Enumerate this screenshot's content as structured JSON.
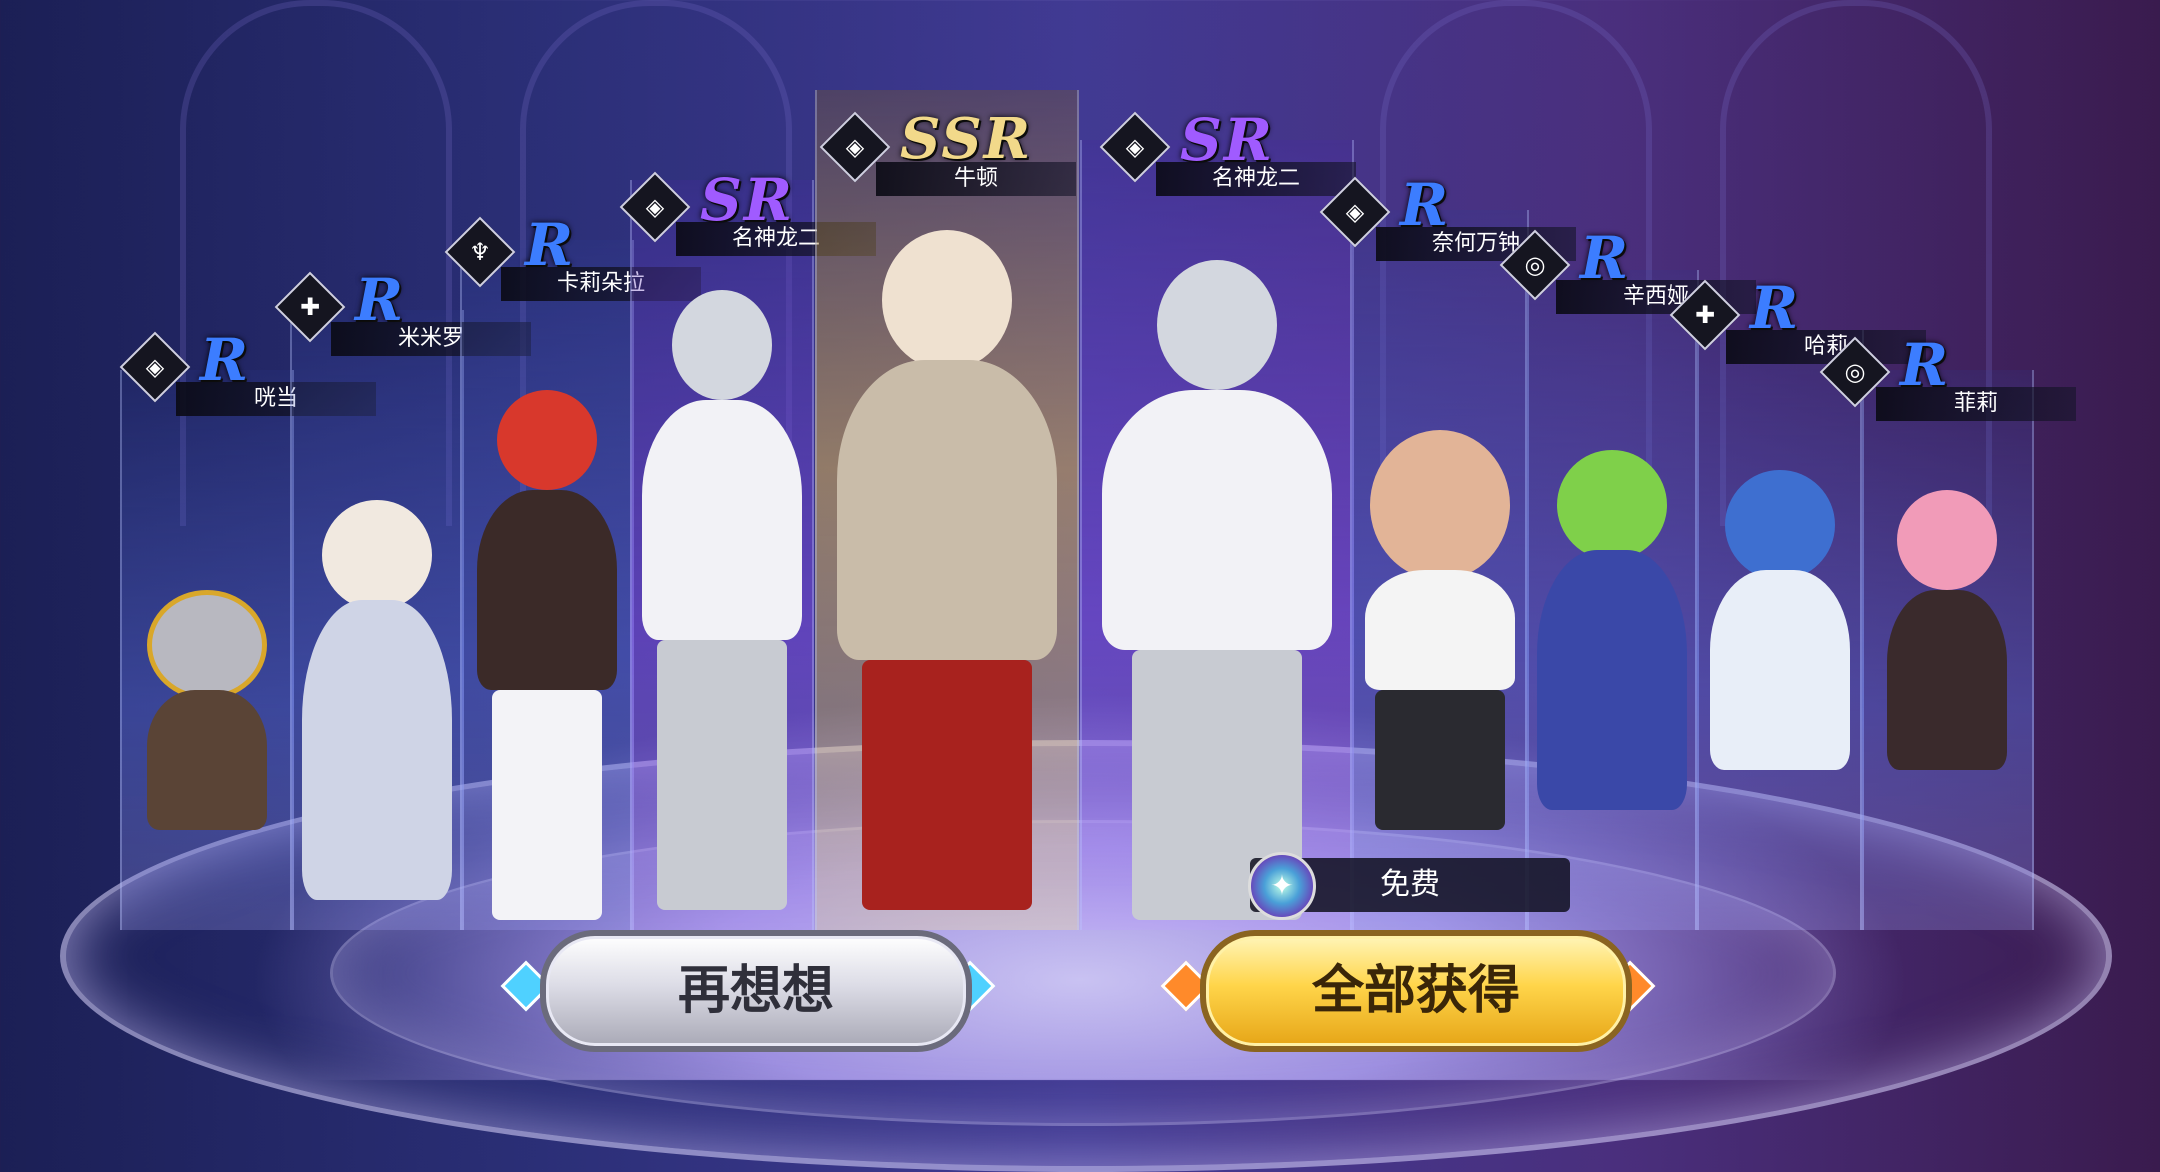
{
  "cards": [
    {
      "rarity": "R",
      "name": "咣当",
      "icon": "shield-icon"
    },
    {
      "rarity": "R",
      "name": "米米罗",
      "icon": "cross-icon"
    },
    {
      "rarity": "R",
      "name": "卡莉朵拉",
      "icon": "trident-icon"
    },
    {
      "rarity": "SR",
      "name": "名神龙二",
      "icon": "shield-icon"
    },
    {
      "rarity": "SSR",
      "name": "牛顿",
      "icon": "shield-icon"
    },
    {
      "rarity": "SR",
      "name": "名神龙二",
      "icon": "shield-icon"
    },
    {
      "rarity": "R",
      "name": "奈何万钟",
      "icon": "shield-icon"
    },
    {
      "rarity": "R",
      "name": "辛西娅",
      "icon": "target-icon"
    },
    {
      "rarity": "R",
      "name": "哈莉",
      "icon": "cross-icon"
    },
    {
      "rarity": "R",
      "name": "菲莉",
      "icon": "target-icon"
    }
  ],
  "free_label": "免费",
  "buttons": {
    "retry": "再想想",
    "claim": "全部获得"
  },
  "colors": {
    "r": "#3c7dff",
    "sr": "#a05bff",
    "ssr": "#f2d98a",
    "claim": "#ffd54a",
    "retry": "#dcdce6"
  }
}
